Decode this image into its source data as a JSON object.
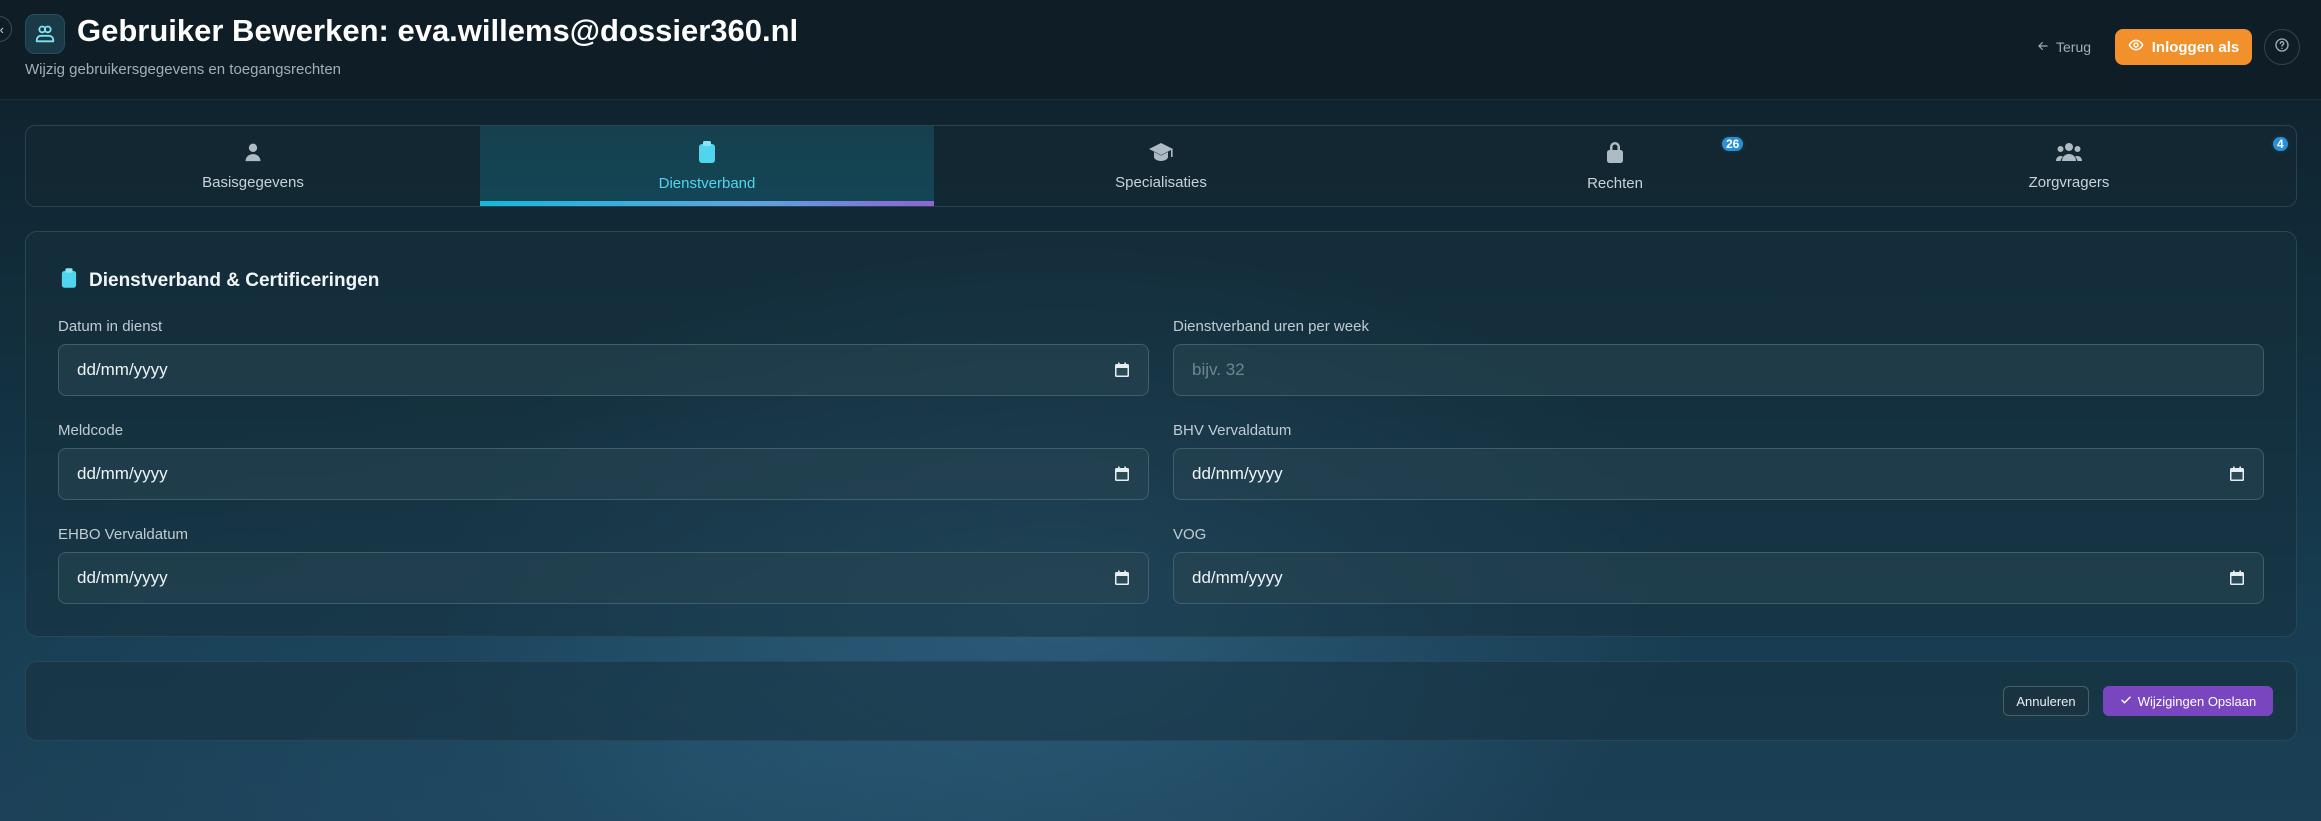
{
  "header": {
    "title": "Gebruiker Bewerken: eva.willems@dossier360.nl",
    "subtitle": "Wijzig gebruikersgegevens en toegangsrechten",
    "back_label": "Terug",
    "impersonate_label": "Inloggen als"
  },
  "tabs": [
    {
      "label": "Basisgegevens",
      "icon": "user-icon",
      "active": false
    },
    {
      "label": "Dienstverband",
      "icon": "clipboard-icon",
      "active": true
    },
    {
      "label": "Specialisaties",
      "icon": "graduation-cap-icon",
      "active": false
    },
    {
      "label": "Rechten",
      "icon": "lock-icon",
      "active": false,
      "badge": "26"
    },
    {
      "label": "Zorgvragers",
      "icon": "users-icon",
      "active": false,
      "badge": "4"
    }
  ],
  "section": {
    "title": "Dienstverband & Certificeringen",
    "fields": {
      "start_date": {
        "label": "Datum in dienst",
        "value": "dd/mm/yyyy"
      },
      "hours": {
        "label": "Dienstverband uren per week",
        "placeholder": "bijv. 32"
      },
      "meldcode": {
        "label": "Meldcode",
        "value": "dd/mm/yyyy"
      },
      "bhv": {
        "label": "BHV Vervaldatum",
        "value": "dd/mm/yyyy"
      },
      "ehbo": {
        "label": "EHBO Vervaldatum",
        "value": "dd/mm/yyyy"
      },
      "vog": {
        "label": "VOG",
        "value": "dd/mm/yyyy"
      }
    }
  },
  "footer": {
    "cancel_label": "Annuleren",
    "save_label": "Wijzigingen Opslaan"
  },
  "colors": {
    "accent": "#4fd6ee",
    "primary_action": "#f2902b",
    "save": "#7a46c0",
    "badge": "#2b8fd6"
  }
}
